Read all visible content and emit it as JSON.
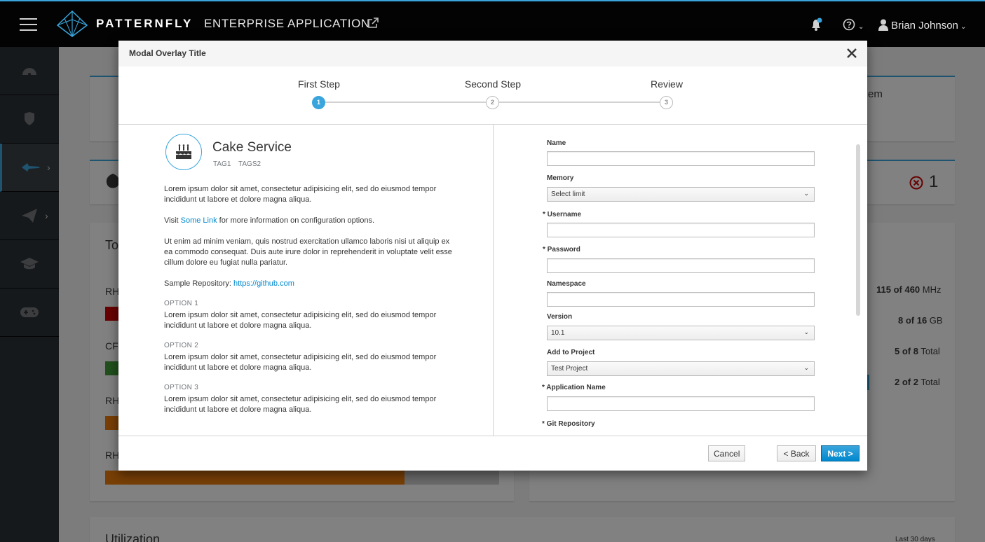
{
  "masthead": {
    "brand_name": "PATTERNFLY",
    "brand_sub": "ENTERPRISE APPLICATION",
    "user_name": "Brian Johnson"
  },
  "background": {
    "card_right_partial_text": "em",
    "section_title_partial": "To",
    "error_count": "1",
    "bar_labels": [
      "RH",
      "CF",
      "RH",
      "RH"
    ],
    "bar_colors": [
      "#cc0000",
      "#3f9c35",
      "#ec7a08",
      "#ec7a08"
    ],
    "utilization_rows": [
      {
        "value": "115 of 460",
        "unit": " MHz"
      },
      {
        "value": "8 of 16",
        "unit": " GB"
      },
      {
        "value": "5 of 8",
        "unit": " Total"
      },
      {
        "value": "2 of 2",
        "unit": " Total"
      }
    ],
    "bottom_bar_fill_fraction": 0.76,
    "utilization_title_partial": "Utilization",
    "last_days": "Last 30 days"
  },
  "modal": {
    "title": "Modal Overlay Title",
    "steps": [
      {
        "label": "First Step",
        "num": "1"
      },
      {
        "label": "Second Step",
        "num": "2"
      },
      {
        "label": "Review",
        "num": "3"
      }
    ],
    "service": {
      "title": "Cake Service",
      "tags": [
        "TAG1",
        "TAGS2"
      ],
      "para1": "Lorem ipsum dolor sit amet, consectetur adipisicing elit, sed do eiusmod tempor incididunt ut labore et dolore magna aliqua.",
      "visit_prefix": "Visit ",
      "visit_link": "Some Link",
      "visit_suffix": " for more information on configuration options.",
      "para2": "Ut enim ad minim veniam, quis nostrud exercitation ullamco laboris nisi ut aliquip ex ea commodo consequat. Duis aute irure dolor in reprehenderit in voluptate velit esse cillum dolore eu fugiat nulla pariatur.",
      "repo_prefix": "Sample Repository: ",
      "repo_link": "https://github.com",
      "options": [
        {
          "label": "OPTION 1",
          "text": "Lorem ipsum dolor sit amet, consectetur adipisicing elit, sed do eiusmod tempor incididunt ut labore et dolore magna aliqua."
        },
        {
          "label": "OPTION 2",
          "text": "Lorem ipsum dolor sit amet, consectetur adipisicing elit, sed do eiusmod tempor incididunt ut labore et dolore magna aliqua."
        },
        {
          "label": "OPTION 3",
          "text": "Lorem ipsum dolor sit amet, consectetur adipisicing elit, sed do eiusmod tempor incididunt ut labore et dolore magna aliqua."
        }
      ]
    },
    "form": {
      "name_label": "Name",
      "name_value": "",
      "memory_label": "Memory",
      "memory_value": "Select limit",
      "username_label": "* Username",
      "username_value": "",
      "password_label": "* Password",
      "password_value": "",
      "namespace_label": "Namespace",
      "namespace_value": "",
      "version_label": "Version",
      "version_value": "10.1",
      "project_label": "Add to Project",
      "project_value": "Test Project",
      "appname_label": "* Application Name",
      "appname_value": "",
      "git_label": "* Git Repository"
    },
    "footer": {
      "cancel": "Cancel",
      "back": "< Back",
      "next": "Next >"
    }
  }
}
